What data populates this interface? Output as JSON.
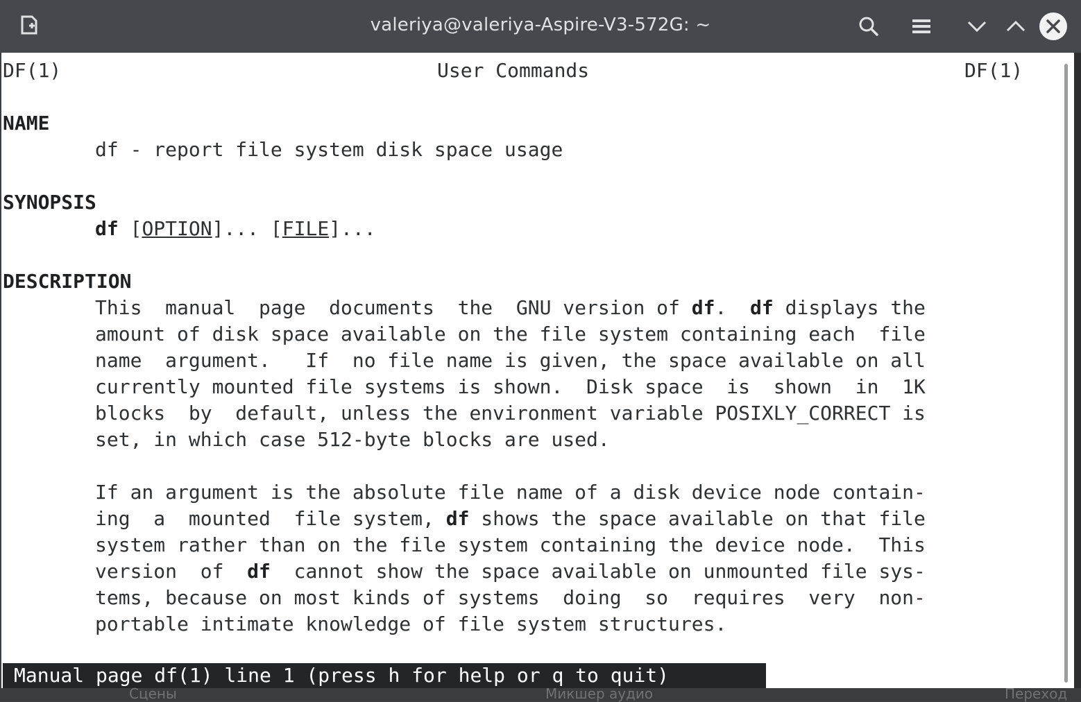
{
  "window": {
    "title": "valeriya@valeriya-Aspire-V3-572G: ~",
    "icons": [
      "new-tab-icon",
      "search-icon",
      "hamburger-menu-icon",
      "chevron-down-icon",
      "chevron-up-icon",
      "close-icon"
    ]
  },
  "man": {
    "header_left": "DF(1)",
    "header_center": "User Commands",
    "header_right": "DF(1)",
    "name_heading": "NAME",
    "name_desc": "df - report file system disk space usage",
    "synopsis_heading": "SYNOPSIS",
    "synopsis_cmd": "df",
    "synopsis_open1": "[",
    "synopsis_option": "OPTION",
    "synopsis_close1": "]... ",
    "synopsis_open2": "[",
    "synopsis_file": "FILE",
    "synopsis_close2": "]...",
    "description_heading": "DESCRIPTION",
    "p1": [
      {
        "a": "This  manual  page  documents  the  GNU version of ",
        "b": "df",
        "c": ".  ",
        "d": "df",
        "e": " displays the"
      },
      "amount of disk space available on the file system containing each  file",
      "name  argument.   If  no file name is given, the space available on all",
      "currently mounted file systems is shown.  Disk space  is  shown  in  1K",
      "blocks  by  default, unless the environment variable POSIXLY_CORRECT is",
      "set, in which case 512-byte blocks are used."
    ],
    "p2": [
      "If an argument is the absolute file name of a disk device node contain-",
      {
        "a": "ing  a  mounted  file system, ",
        "b": "df",
        "c": " shows the space available on that file"
      },
      "system rather than on the file system containing the device node.  This",
      {
        "a": "version  of  ",
        "b": "df",
        "c": "  cannot show the space available on unmounted file sys-"
      },
      "tems, because on most kinds of systems  doing  so  requires  very  non-",
      "portable intimate knowledge of file system structures."
    ]
  },
  "status": {
    "text": "Manual page df(1) line 1 (press h for help or q to quit)"
  },
  "taskbar": {
    "items": [
      "Сцены",
      "Микшер аудио",
      "Переход"
    ]
  }
}
